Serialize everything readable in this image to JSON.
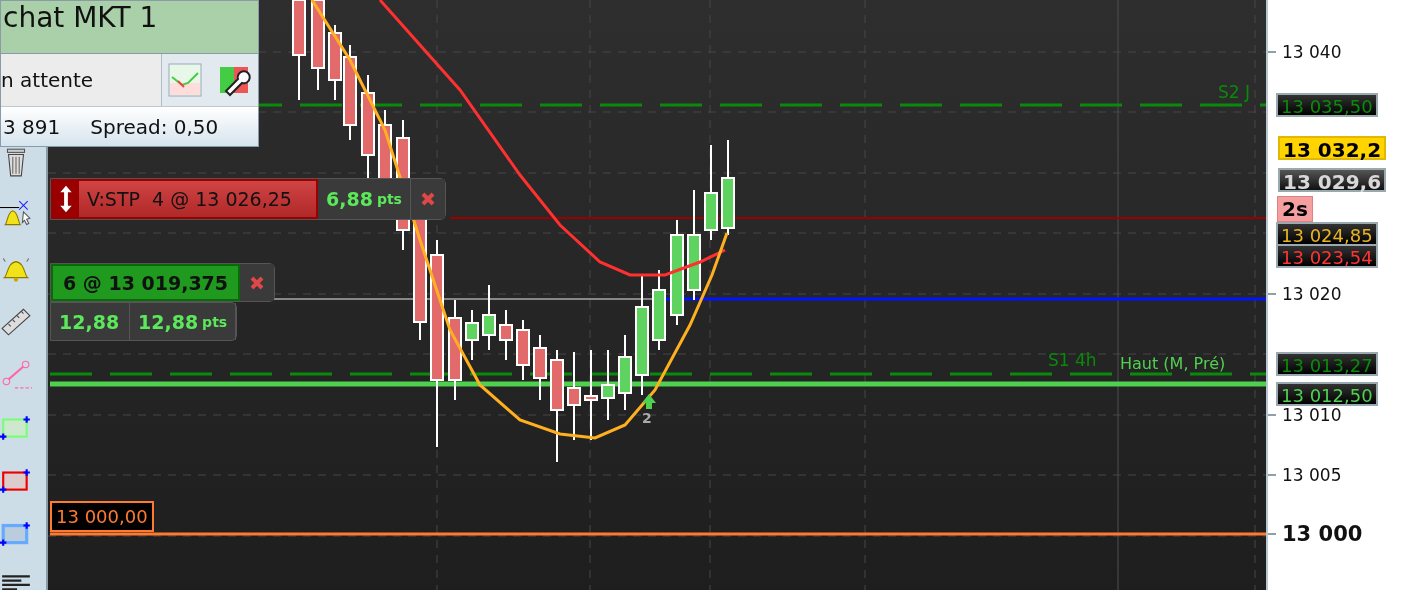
{
  "order_panel": {
    "title": "chat MKT 1",
    "status": "n attente",
    "volume": "3 891",
    "spread": "Spread: 0,50"
  },
  "orders": [
    {
      "kind": "stop",
      "label": "V:STP  4 @ 13 026,25",
      "gain": "6,88",
      "unit": "pts"
    },
    {
      "kind": "position",
      "label": "6 @ 13 019,375",
      "value": "12,88",
      "gain": "12,88",
      "unit": "pts"
    }
  ],
  "price_alert": "13 000,00",
  "level_labels": [
    {
      "kind": "pivot",
      "text": "S2 J"
    },
    {
      "kind": "pivot",
      "text": "S1 4h"
    },
    {
      "kind": "high",
      "text": "Haut (M, Pré)"
    }
  ],
  "signal_count": "2",
  "axis_ticks": [
    "13 040",
    "13 020",
    "13 010",
    "13 005",
    "13 000"
  ],
  "axis_tags": [
    {
      "kind": "pivot",
      "text": "13 035,50"
    },
    {
      "kind": "ask",
      "text": "13 032,2"
    },
    {
      "kind": "last",
      "text": "13 029,6"
    },
    {
      "kind": "slow-average",
      "text": "13 024,85"
    },
    {
      "kind": "fast-average",
      "text": "13 023,54"
    },
    {
      "kind": "pivot",
      "text": "13 013,27"
    },
    {
      "kind": "high",
      "text": "13 012,50"
    }
  ],
  "timer": "2s"
}
